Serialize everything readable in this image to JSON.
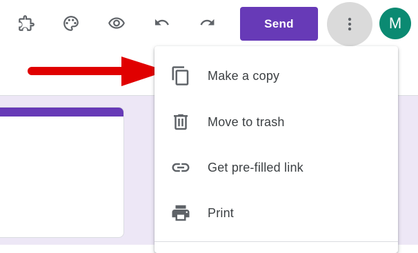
{
  "toolbar": {
    "icons": [
      "puzzle-icon",
      "palette-icon",
      "eye-icon",
      "undo-icon",
      "redo-icon"
    ],
    "send_label": "Send",
    "more_icon": "more-vert-icon",
    "avatar_initial": "M",
    "accent_color": "#673ab7",
    "avatar_color": "#0b8a72"
  },
  "menu": {
    "items": [
      {
        "label": "Make a copy",
        "icon": "copy-icon"
      },
      {
        "label": "Move to trash",
        "icon": "trash-icon"
      },
      {
        "label": "Get pre-filled link",
        "icon": "link-icon"
      },
      {
        "label": "Print",
        "icon": "print-icon"
      }
    ]
  },
  "annotation": {
    "arrow_color": "#e00000"
  },
  "canvas": {
    "background": "#ede7f6"
  }
}
